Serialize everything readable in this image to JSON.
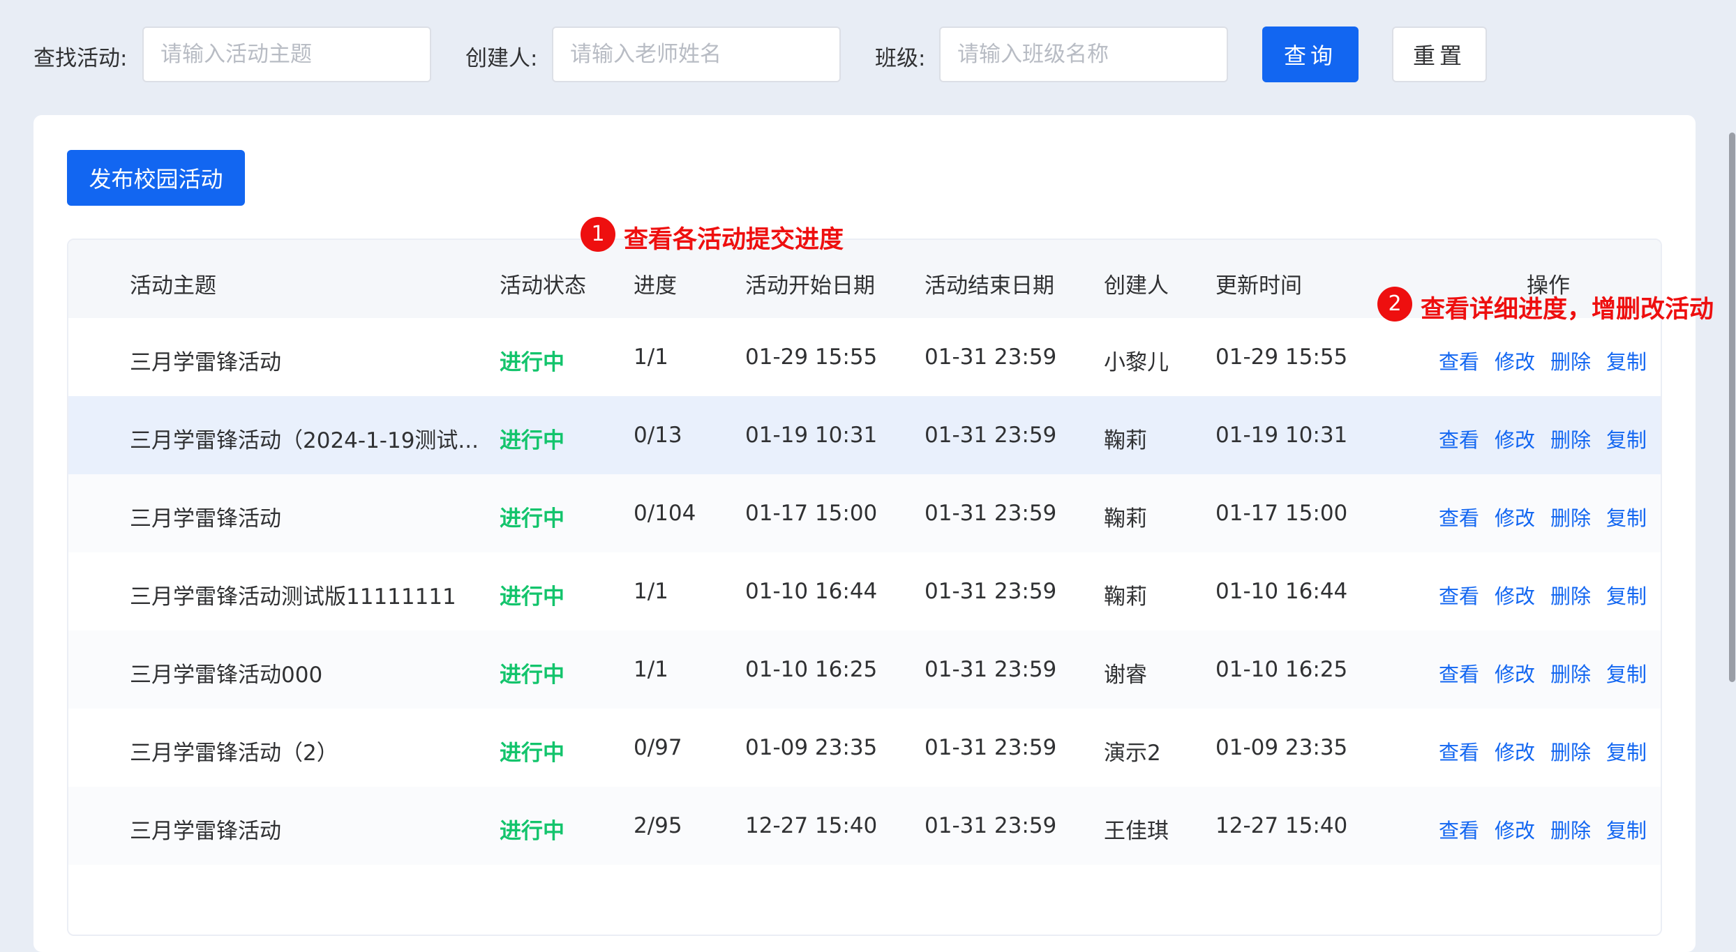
{
  "search": {
    "activity_label": "查找活动:",
    "activity_placeholder": "请输入活动主题",
    "creator_label": "创建人:",
    "creator_placeholder": "请输入老师姓名",
    "class_label": "班级:",
    "class_placeholder": "请输入班级名称",
    "query_button": "查询",
    "reset_button": "重置"
  },
  "toolbar": {
    "publish_button": "发布校园活动"
  },
  "table": {
    "headers": {
      "topic": "活动主题",
      "status": "活动状态",
      "progress": "进度",
      "start": "活动开始日期",
      "end": "活动结束日期",
      "creator": "创建人",
      "updated": "更新时间",
      "actions": "操作"
    },
    "action_labels": {
      "view": "查看",
      "edit": "修改",
      "delete": "删除",
      "copy": "复制"
    },
    "rows": [
      {
        "topic": "三月学雷锋活动",
        "status": "进行中",
        "progress": "1/1",
        "start": "01-29 15:55",
        "end": "01-31 23:59",
        "creator": "小黎儿",
        "updated": "01-29 15:55"
      },
      {
        "topic": "三月学雷锋活动（2024-1-19测试...",
        "status": "进行中",
        "progress": "0/13",
        "start": "01-19 10:31",
        "end": "01-31 23:59",
        "creator": "鞠莉",
        "updated": "01-19 10:31"
      },
      {
        "topic": "三月学雷锋活动",
        "status": "进行中",
        "progress": "0/104",
        "start": "01-17 15:00",
        "end": "01-31 23:59",
        "creator": "鞠莉",
        "updated": "01-17 15:00"
      },
      {
        "topic": "三月学雷锋活动测试版11111111",
        "status": "进行中",
        "progress": "1/1",
        "start": "01-10 16:44",
        "end": "01-31 23:59",
        "creator": "鞠莉",
        "updated": "01-10 16:44"
      },
      {
        "topic": "三月学雷锋活动000",
        "status": "进行中",
        "progress": "1/1",
        "start": "01-10 16:25",
        "end": "01-31 23:59",
        "creator": "谢睿",
        "updated": "01-10 16:25"
      },
      {
        "topic": "三月学雷锋活动（2）",
        "status": "进行中",
        "progress": "0/97",
        "start": "01-09 23:35",
        "end": "01-31 23:59",
        "creator": "演示2",
        "updated": "01-09 23:35"
      },
      {
        "topic": "三月学雷锋活动",
        "status": "进行中",
        "progress": "2/95",
        "start": "12-27 15:40",
        "end": "01-31 23:59",
        "creator": "王佳琪",
        "updated": "12-27 15:40"
      }
    ]
  },
  "annotations": {
    "one": {
      "number": "1",
      "text": "查看各活动提交进度"
    },
    "two": {
      "number": "2",
      "text": "查看详细进度，增删改活动"
    }
  },
  "colors": {
    "primary": "#1266f1",
    "status_active": "#13c46c",
    "annotation": "#ee0f0f",
    "page_background": "#e8edf5"
  }
}
